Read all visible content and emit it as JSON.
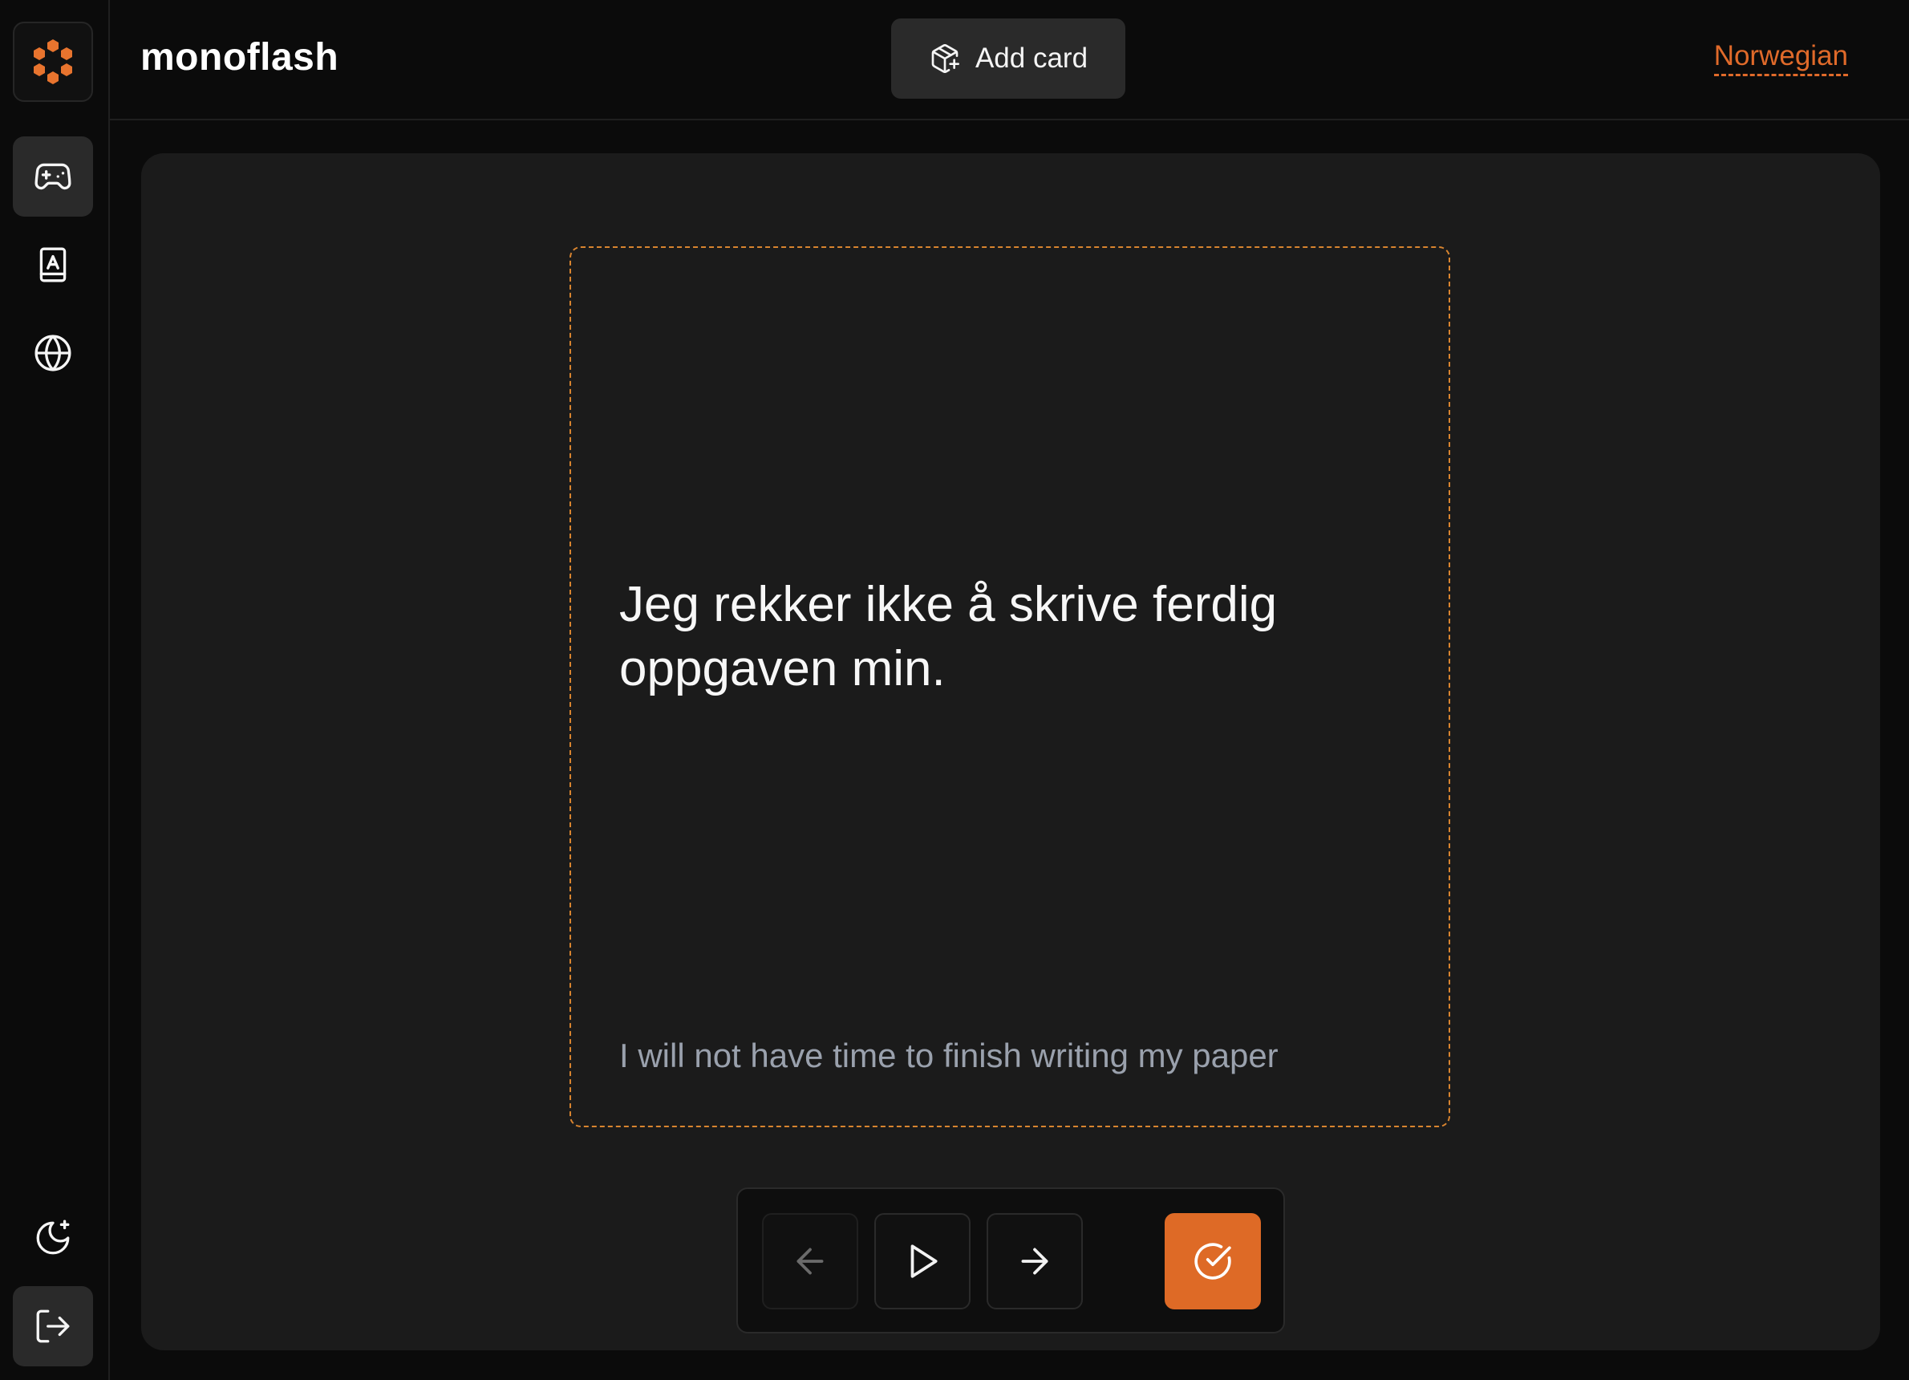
{
  "app": {
    "title": "monoflash"
  },
  "header": {
    "add_card_label": "Add card",
    "language": "Norwegian"
  },
  "sidebar": {
    "items": [
      {
        "name": "play",
        "icon": "gamepad-icon",
        "active": true
      },
      {
        "name": "dictionary",
        "icon": "book-a-icon",
        "active": false
      },
      {
        "name": "languages",
        "icon": "globe-icon",
        "active": false
      }
    ],
    "bottom": [
      {
        "name": "theme",
        "icon": "moon-star-icon"
      },
      {
        "name": "logout",
        "icon": "log-out-icon"
      }
    ]
  },
  "card": {
    "front": "Jeg rekker ikke å skrive ferdig oppgaven min.",
    "back": "I will not have time to finish writing my paper"
  },
  "controls": [
    {
      "name": "previous",
      "icon": "arrow-left-icon",
      "disabled": true
    },
    {
      "name": "play-audio",
      "icon": "play-icon",
      "disabled": false
    },
    {
      "name": "next",
      "icon": "arrow-right-icon",
      "disabled": false
    },
    {
      "name": "mark-learned",
      "icon": "check-circle-icon",
      "primary": true
    }
  ],
  "colors": {
    "accent": "#de6a26",
    "background": "#0b0b0b",
    "panel": "#1b1b1b",
    "muted_text": "#9aa1ad"
  }
}
